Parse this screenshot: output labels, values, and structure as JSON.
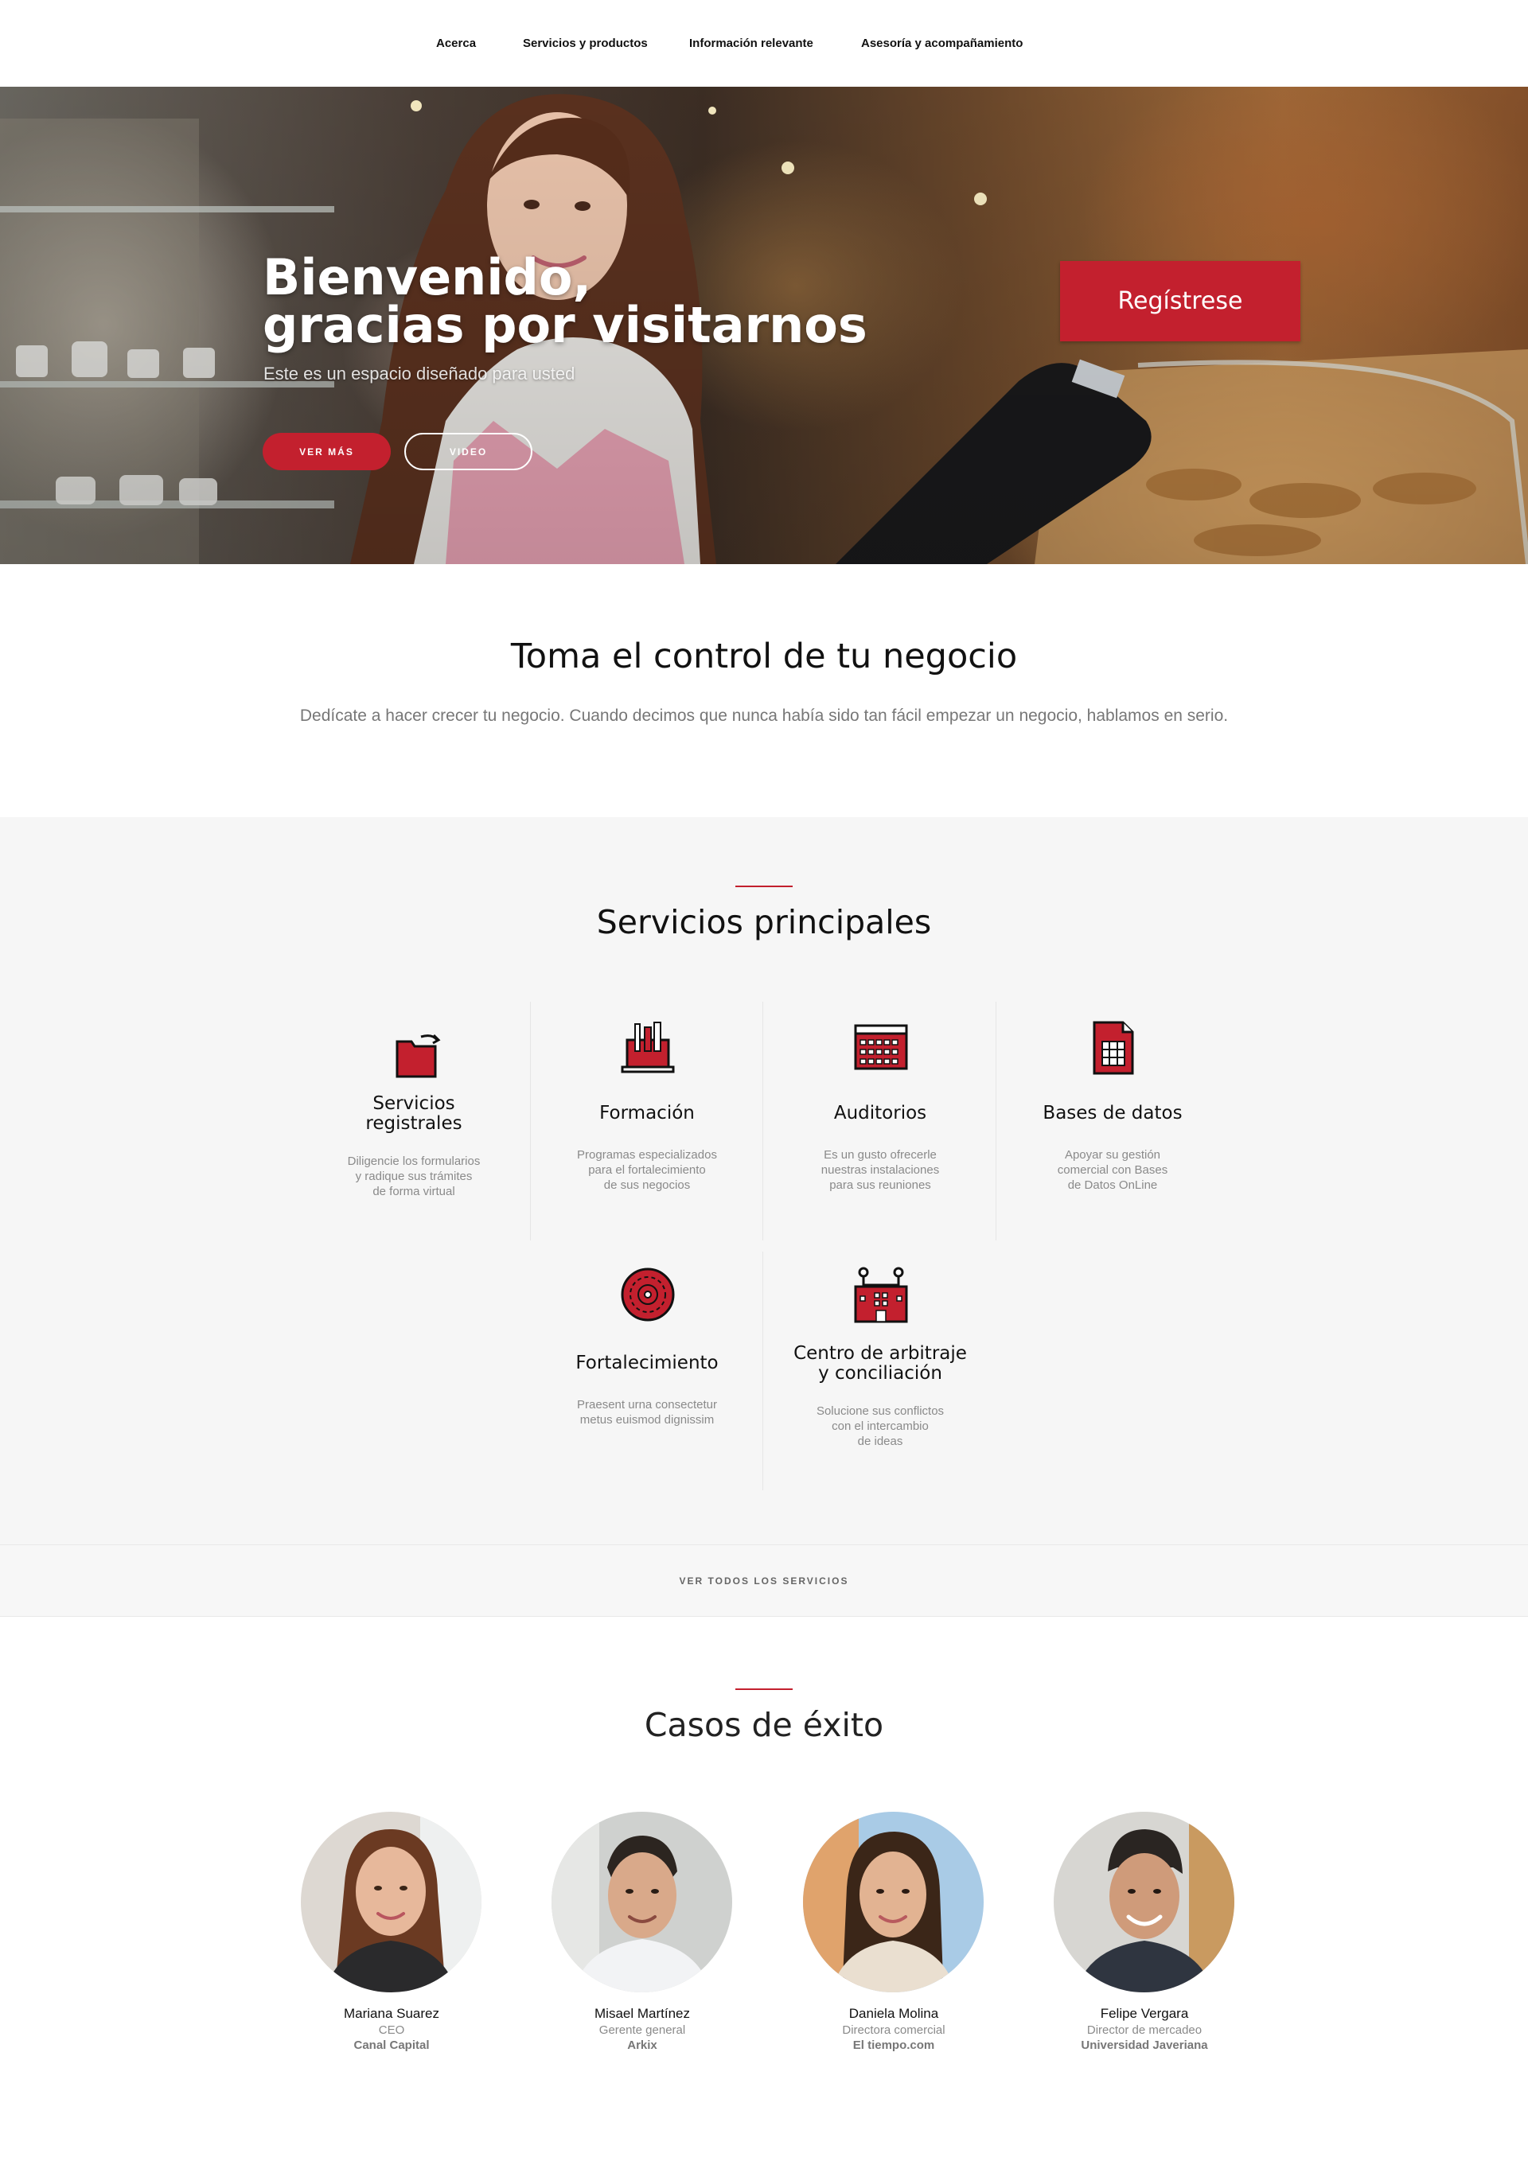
{
  "nav": {
    "items": [
      {
        "label": "Acerca"
      },
      {
        "label": "Servicios y productos"
      },
      {
        "label": "Información relevante"
      },
      {
        "label": "Asesoría y acompañamiento"
      }
    ]
  },
  "hero": {
    "title_line1": "Bienvenido,",
    "title_line2": "gracias por visitarnos",
    "subtitle": "Este es un espacio diseñado para usted",
    "more_button": "VER MÁS",
    "video_button": "VIDEO",
    "register_button": "Regístrese"
  },
  "intro": {
    "title": "Toma el control de tu negocio",
    "text": "Dedícate a hacer crecer tu negocio. Cuando decimos que nunca había sido tan fácil empezar un negocio, hablamos en serio."
  },
  "services": {
    "title": "Servicios principales",
    "items": [
      {
        "title_l1": "Servicios",
        "title_l2": "registrales",
        "desc": [
          "Diligencie los formularios",
          "y radique sus trámites",
          "de forma virtual"
        ],
        "icon": "folder-share-icon"
      },
      {
        "title_l1": "Formación",
        "title_l2": "",
        "desc": [
          "Programas especializados",
          "para el fortalecimiento",
          "de sus negocios"
        ],
        "icon": "laptop-tools-icon"
      },
      {
        "title_l1": "Auditorios",
        "title_l2": "",
        "desc": [
          "Es un gusto ofrecerle",
          "nuestras instalaciones",
          "para sus reuniones"
        ],
        "icon": "auditorium-icon"
      },
      {
        "title_l1": "Bases de datos",
        "title_l2": "",
        "desc": [
          "Apoyar su gestión",
          "comercial con Bases",
          "de Datos OnLine"
        ],
        "icon": "database-document-icon"
      },
      {
        "title_l1": "Fortalecimiento",
        "title_l2": "",
        "desc": [
          "Praesent urna consectetur",
          "metus euismod dignissim"
        ],
        "icon": "gear-circle-icon"
      },
      {
        "title_l1": "Centro de arbitraje",
        "title_l2": "y conciliación",
        "desc": [
          "Solucione sus conflictos",
          "con el intercambio",
          "de ideas"
        ],
        "icon": "building-people-icon"
      }
    ],
    "all_label": "VER TODOS LOS SERVICIOS"
  },
  "cases": {
    "title": "Casos de éxito",
    "people": [
      {
        "name": "Mariana Suarez",
        "role": "CEO",
        "company": "Canal Capital"
      },
      {
        "name": "Misael Martínez",
        "role": "Gerente general",
        "company": "Arkix"
      },
      {
        "name": "Daniela Molina",
        "role": "Directora comercial",
        "company": "El tiempo.com"
      },
      {
        "name": "Felipe Vergara",
        "role": "Director de mercadeo",
        "company": "Universidad Javeriana"
      }
    ]
  },
  "colors": {
    "accent": "#c3202e",
    "section_bg": "#f6f6f6"
  }
}
